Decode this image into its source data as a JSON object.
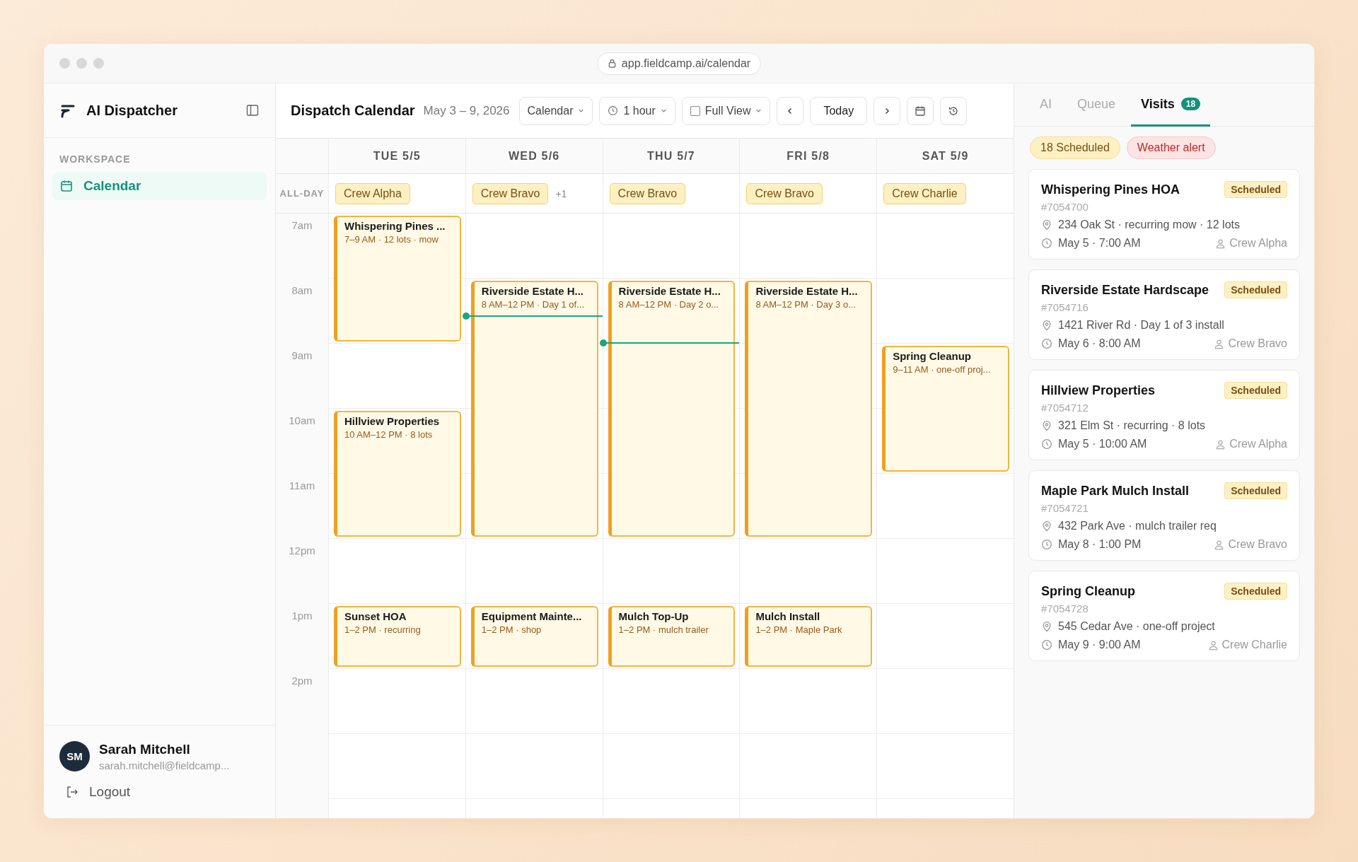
{
  "window": {
    "url": "app.fieldcamp.ai/calendar"
  },
  "sidebar": {
    "title": "AI Dispatcher",
    "section": "WORKSPACE",
    "items": [
      {
        "label": "Calendar",
        "selected": true
      }
    ],
    "user": {
      "initials": "SM",
      "name": "Sarah Mitchell",
      "email": "sarah.mitchell@fieldcamp..."
    },
    "logout": "Logout"
  },
  "header": {
    "title": "Dispatch Calendar",
    "date_range": "May 3 – 9, 2026",
    "view_select": "Calendar",
    "interval_select": "1 hour",
    "full_view": {
      "label": "Full View",
      "checked": false
    },
    "today": "Today"
  },
  "calendar": {
    "all_day_label": "ALL-DAY",
    "hours": [
      "7am",
      "8am",
      "9am",
      "10am",
      "11am",
      "12pm",
      "1pm",
      "2pm"
    ],
    "days": [
      {
        "label": "TUE 5/5",
        "all_day": "Crew Alpha",
        "events": [
          {
            "title": "Whispering Pines ...",
            "detail": "7–9 AM · 12 lots · mow"
          },
          {
            "title": "Hillview Properties",
            "detail": "10 AM–12 PM · 8 lots"
          },
          {
            "title": "Sunset HOA",
            "detail": "1–2 PM · recurring"
          }
        ]
      },
      {
        "label": "WED 5/6",
        "all_day": "Crew Bravo",
        "all_day_more": "+1",
        "time_marker": {
          "level": 0.83
        },
        "events": [
          {
            "title": "Riverside Estate H...",
            "detail": "8 AM–12 PM · Day 1 of..."
          },
          {
            "title": "Equipment Mainte...",
            "detail": "1–2 PM · shop"
          }
        ]
      },
      {
        "label": "THU 5/7",
        "all_day": "Crew Bravo",
        "time_marker": {
          "level": 0.786
        },
        "events": [
          {
            "title": "Riverside Estate H...",
            "detail": "8 AM–12 PM · Day 2 o..."
          },
          {
            "title": "Mulch Top-Up",
            "detail": "1–2 PM · mulch trailer"
          }
        ]
      },
      {
        "label": "FRI 5/8",
        "all_day": "Crew Bravo",
        "events": [
          {
            "title": "Riverside Estate H...",
            "detail": "8 AM–12 PM · Day 3 o..."
          },
          {
            "title": "Mulch Install",
            "detail": "1–2 PM · Maple Park"
          }
        ]
      },
      {
        "label": "SAT 5/9",
        "all_day": "Crew Charlie",
        "events": [
          {
            "title": "Spring Cleanup",
            "detail": "9–11 AM · one-off proj..."
          }
        ]
      }
    ]
  },
  "panel": {
    "tabs": [
      {
        "label": "AI",
        "selected": false
      },
      {
        "label": "Queue",
        "selected": false
      },
      {
        "label": "Visits",
        "selected": true,
        "badge": "18"
      }
    ],
    "chips": [
      {
        "label": "18 Scheduled",
        "kind": "scheduled"
      },
      {
        "label": "Weather alert",
        "kind": "alert"
      }
    ],
    "visits": [
      {
        "title": "Whispering Pines HOA",
        "status": "Scheduled",
        "id": "#7054700",
        "address": "234 Oak St · recurring mow · 12 lots",
        "time": "May 5 · 7:00 AM",
        "crew": "Crew Alpha"
      },
      {
        "title": "Riverside Estate Hardscape",
        "status": "Scheduled",
        "id": "#7054716",
        "address": "1421 River Rd · Day 1 of 3 install",
        "time": "May 6 · 8:00 AM",
        "crew": "Crew Bravo"
      },
      {
        "title": "Hillview Properties",
        "status": "Scheduled",
        "id": "#7054712",
        "address": "321 Elm St · recurring · 8 lots",
        "time": "May 5 · 10:00 AM",
        "crew": "Crew Alpha"
      },
      {
        "title": "Maple Park Mulch Install",
        "status": "Scheduled",
        "id": "#7054721",
        "address": "432 Park Ave · mulch trailer req",
        "time": "May 8 · 1:00 PM",
        "crew": "Crew Bravo"
      },
      {
        "title": "Spring Cleanup",
        "status": "Scheduled",
        "id": "#7054728",
        "address": "545 Cedar Ave · one-off project",
        "time": "May 9 · 9:00 AM",
        "crew": "Crew Charlie"
      }
    ]
  }
}
